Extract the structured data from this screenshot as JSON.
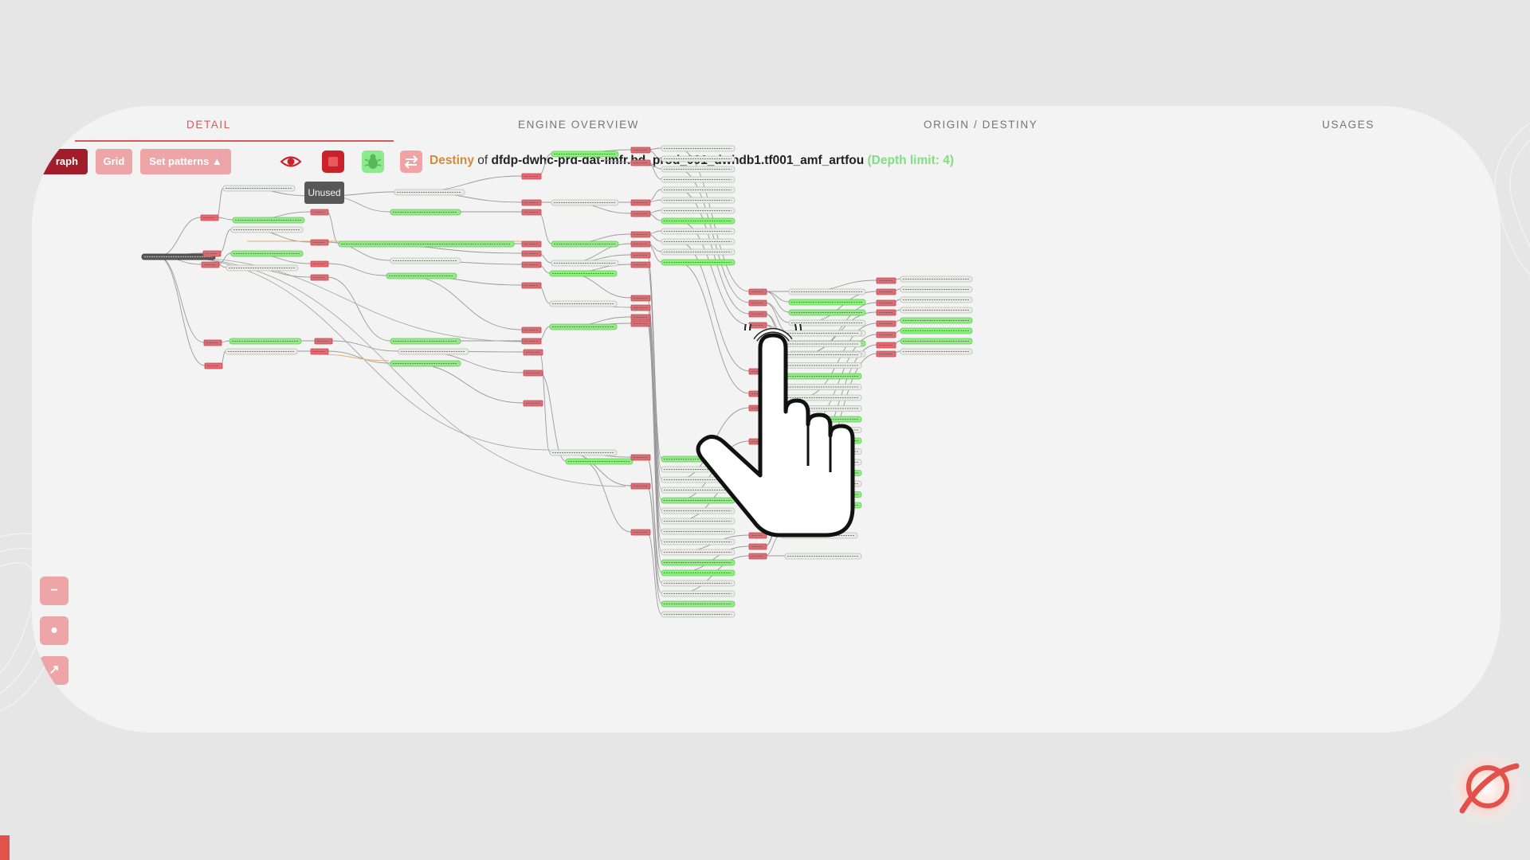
{
  "tabs": [
    {
      "label": "DETAIL"
    },
    {
      "label": "ENGINE OVERVIEW"
    },
    {
      "label": "ORIGIN / DESTINY"
    },
    {
      "label": "USAGES"
    }
  ],
  "toolbar": {
    "graph_label": "raph",
    "grid_label": "Grid",
    "patterns_label": "Set patterns ▲",
    "tooltip": "Unused",
    "icons": [
      "eye-icon",
      "unused-icon",
      "bug-icon",
      "swap-icon"
    ]
  },
  "headline": {
    "word": "Destiny",
    "of": " of ",
    "object": "dfdp-dwhc-prd-dat-lmfr.bd_prod_001_dwhdb1.tf001_amf_artfou",
    "depth": " (Depth limit: 4)"
  },
  "zoom_controls": [
    {
      "label": "−"
    },
    {
      "label": "●"
    },
    {
      "label": "↗"
    }
  ],
  "colors": {
    "accent": "#d75a5a",
    "graph_button": "#a21d2a",
    "soft_button": "#eda5a7",
    "node_red": "#e06b72",
    "node_green": "#8ef07f",
    "node_gray": "#e9ece6",
    "root_node": "#5a5a5a",
    "depth_text": "#7ee07e",
    "destiny_text": "#d28a3a"
  }
}
